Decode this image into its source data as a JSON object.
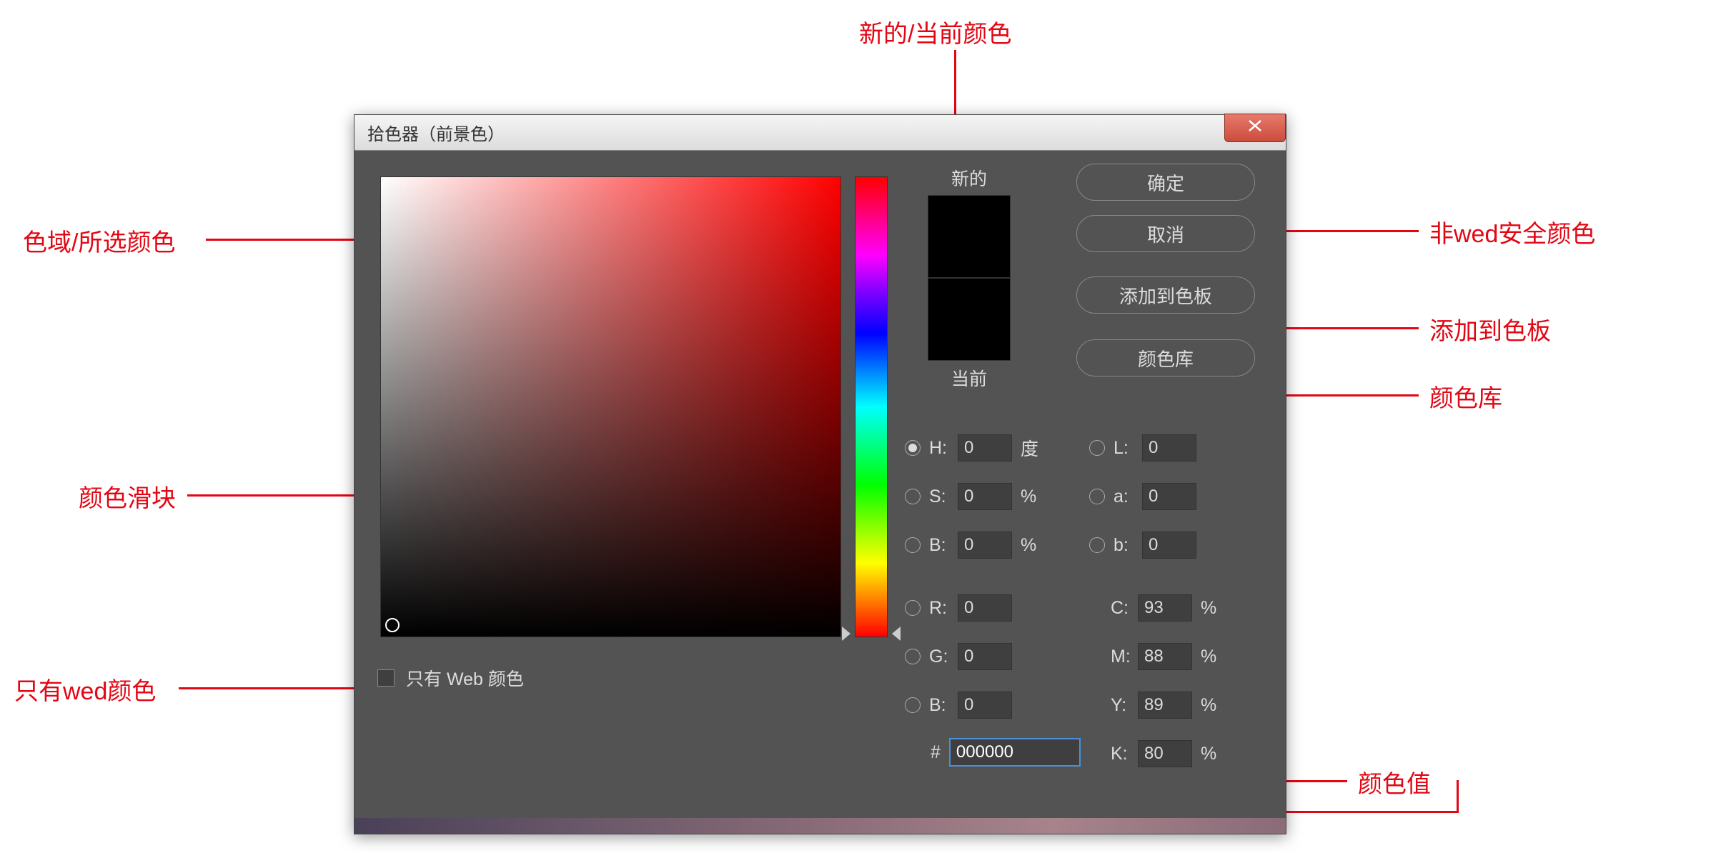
{
  "annotations": {
    "new_current": "新的/当前颜色",
    "gamut": "色域/所选颜色",
    "slider": "颜色滑块",
    "web_only": "只有wed颜色",
    "not_websafe": "非wed安全颜色",
    "add_swatch": "添加到色板",
    "color_lib": "颜色库",
    "color_value": "颜色值"
  },
  "window": {
    "title": "拾色器（前景色）"
  },
  "swatch": {
    "new_label": "新的",
    "current_label": "当前"
  },
  "buttons": {
    "ok": "确定",
    "cancel": "取消",
    "add": "添加到色板",
    "lib": "颜色库"
  },
  "fields": {
    "H": {
      "label": "H:",
      "value": "0",
      "unit": "度"
    },
    "S": {
      "label": "S:",
      "value": "0",
      "unit": "%"
    },
    "Bv": {
      "label": "B:",
      "value": "0",
      "unit": "%"
    },
    "L": {
      "label": "L:",
      "value": "0"
    },
    "av": {
      "label": "a:",
      "value": "0"
    },
    "bv": {
      "label": "b:",
      "value": "0"
    },
    "R": {
      "label": "R:",
      "value": "0"
    },
    "G": {
      "label": "G:",
      "value": "0"
    },
    "Bc": {
      "label": "B:",
      "value": "0"
    },
    "C": {
      "label": "C:",
      "value": "93",
      "unit": "%"
    },
    "M": {
      "label": "M:",
      "value": "88",
      "unit": "%"
    },
    "Y": {
      "label": "Y:",
      "value": "89",
      "unit": "%"
    },
    "K": {
      "label": "K:",
      "value": "80",
      "unit": "%"
    }
  },
  "hex": {
    "label": "#",
    "value": "000000"
  },
  "webonly": {
    "label": "只有 Web 颜色"
  }
}
